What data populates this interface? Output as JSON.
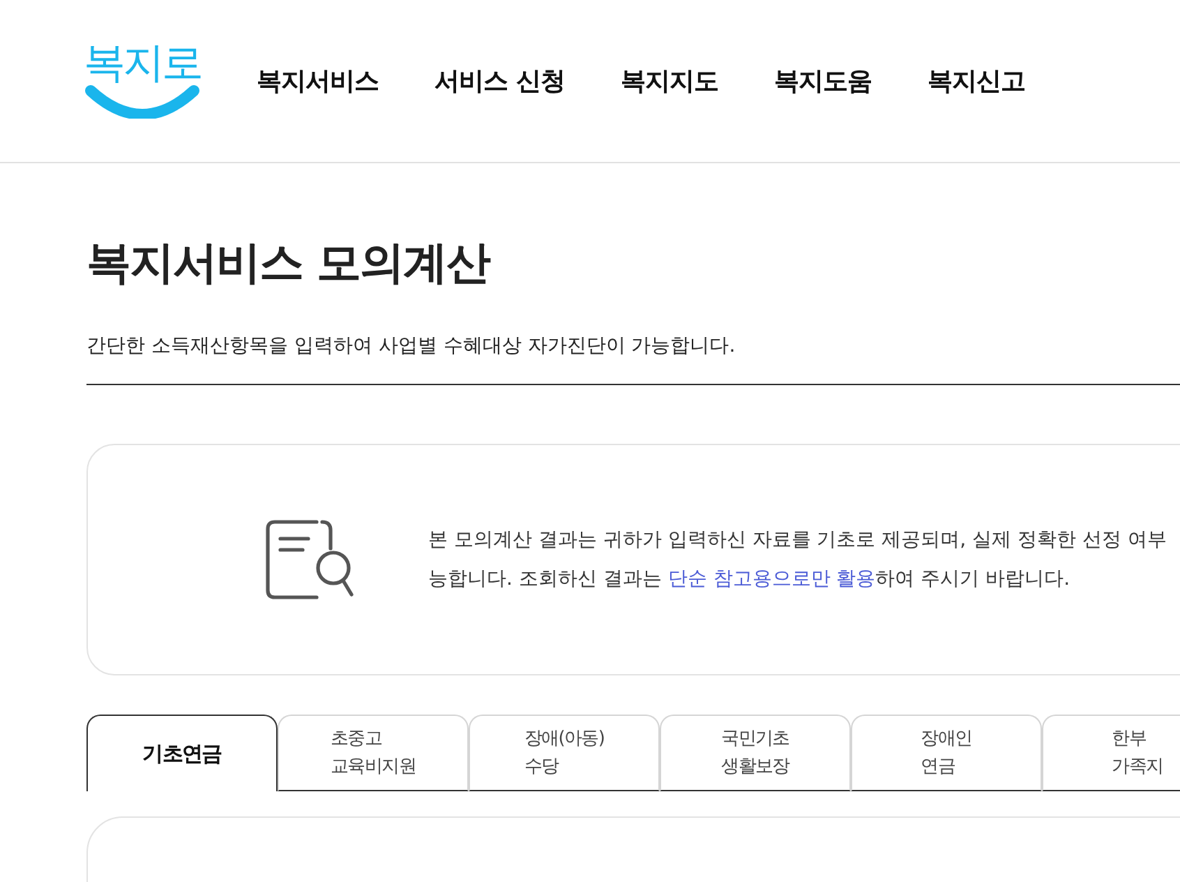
{
  "header": {
    "logo": "복지로",
    "nav": [
      "복지서비스",
      "서비스 신청",
      "복지지도",
      "복지도움",
      "복지신고"
    ]
  },
  "page": {
    "title": "복지서비스 모의계산",
    "description": "간단한 소득재산항목을 입력하여 사업별 수혜대상 자가진단이 가능합니다."
  },
  "notice": {
    "line_1": "본 모의계산 결과는 귀하가 입력하신 자료를 기초로 제공되며, 실제 정확한 선정 여부",
    "line_2_before": "능합니다. 조회하신 결과는 ",
    "line_2_highlight": "단순 참고용으로만 활용",
    "line_2_after": "하여 주시기 바랍니다."
  },
  "tabs": [
    {
      "lines": [
        "기초연금"
      ],
      "selected": true
    },
    {
      "lines": [
        "초중고",
        "교육비지원"
      ],
      "selected": false
    },
    {
      "lines": [
        "장애(아동)",
        "수당"
      ],
      "selected": false
    },
    {
      "lines": [
        "국민기초",
        "생활보장"
      ],
      "selected": false
    },
    {
      "lines": [
        "장애인",
        "연금"
      ],
      "selected": false
    },
    {
      "lines": [
        "한부",
        "가족지"
      ],
      "selected": false
    }
  ]
}
